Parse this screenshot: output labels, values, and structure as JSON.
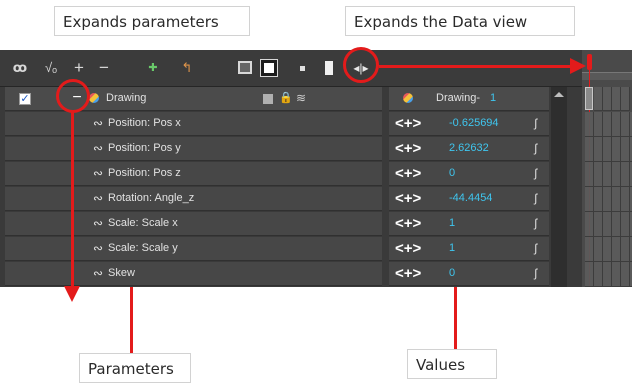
{
  "callouts": {
    "expands_parameters": "Expands parameters",
    "expands_data_view": "Expands the Data view",
    "parameters": "Parameters",
    "values": "Values"
  },
  "layer": {
    "name": "Drawing",
    "checked": true
  },
  "data_view": {
    "layer_label": "Drawing-",
    "frame": "1"
  },
  "parameters": [
    {
      "label": "Position: Pos x",
      "value": "-0.625694"
    },
    {
      "label": "Position: Pos y",
      "value": "2.62632"
    },
    {
      "label": "Position: Pos z",
      "value": "0"
    },
    {
      "label": "Rotation: Angle_z",
      "value": "-44.4454"
    },
    {
      "label": "Scale: Scale x",
      "value": "1"
    },
    {
      "label": "Scale: Scale y",
      "value": "1"
    },
    {
      "label": "Skew",
      "value": "0"
    }
  ],
  "arrows_glyph": "<+>",
  "colors": {
    "annotation_red": "#e31b1b",
    "value_blue": "#3fc6ef",
    "panel_bg": "#3a3a3a",
    "row_bg": "#474747"
  },
  "icons": {
    "toolbar": [
      "show-all-icon",
      "animated-icon",
      "add-layer-icon",
      "remove-layer-icon",
      "add-peg-icon",
      "parent-peg-icon",
      "screen-icon",
      "thumbnail-icon",
      "small-square-icon",
      "white-rect-icon",
      "expand-data-view-icon"
    ],
    "parameter": "function-curve-icon"
  }
}
